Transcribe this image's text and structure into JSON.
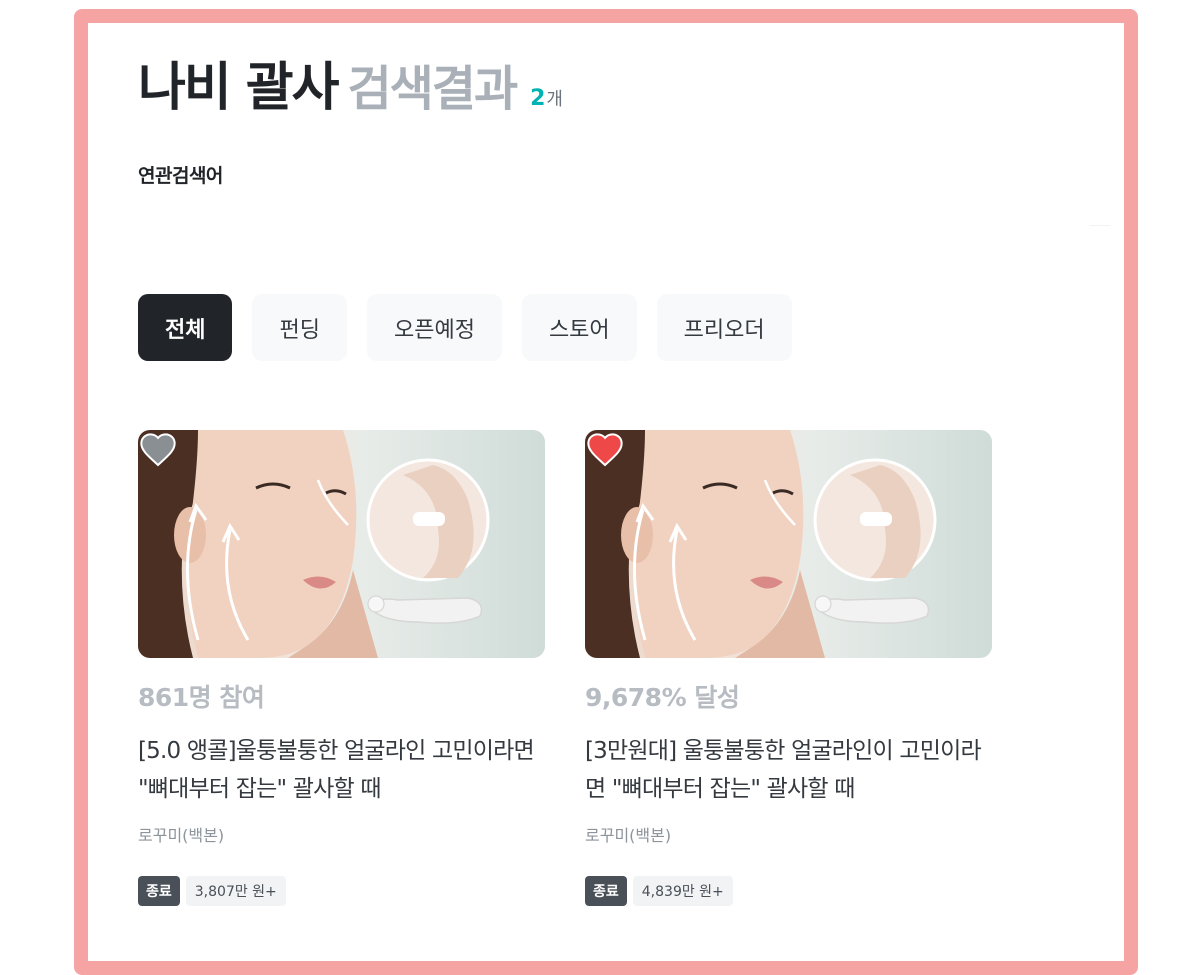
{
  "header": {
    "keyword": "나비 괄사",
    "suffix": "검색결과",
    "count": "2",
    "count_unit": "개"
  },
  "related": {
    "label": "연관검색어"
  },
  "tabs": [
    {
      "label": "전체",
      "active": true
    },
    {
      "label": "펀딩",
      "active": false
    },
    {
      "label": "오픈예정",
      "active": false
    },
    {
      "label": "스토어",
      "active": false
    },
    {
      "label": "프리오더",
      "active": false
    }
  ],
  "cards": [
    {
      "metric": "861명 참여",
      "title": "[5.0 앵콜]울퉁불퉁한 얼굴라인 고민이라면 \"뼈대부터 잡는\" 괄사할 때",
      "maker": "로꾸미(백본)",
      "status": "종료",
      "amount": "3,807만 원+",
      "liked": false,
      "heart_color": "#8a8f94"
    },
    {
      "metric": "9,678% 달성",
      "title": "[3만원대] 울퉁불퉁한 얼굴라인이 고민이라면 \"뼈대부터 잡는\" 괄사할 때",
      "maker": "로꾸미(백본)",
      "status": "종료",
      "amount": "4,839만 원+",
      "liked": true,
      "heart_color": "#ef4848"
    }
  ],
  "colors": {
    "frame_border": "#f6a3a3",
    "count_accent": "#00b2b2",
    "active_tab_bg": "#212529"
  }
}
